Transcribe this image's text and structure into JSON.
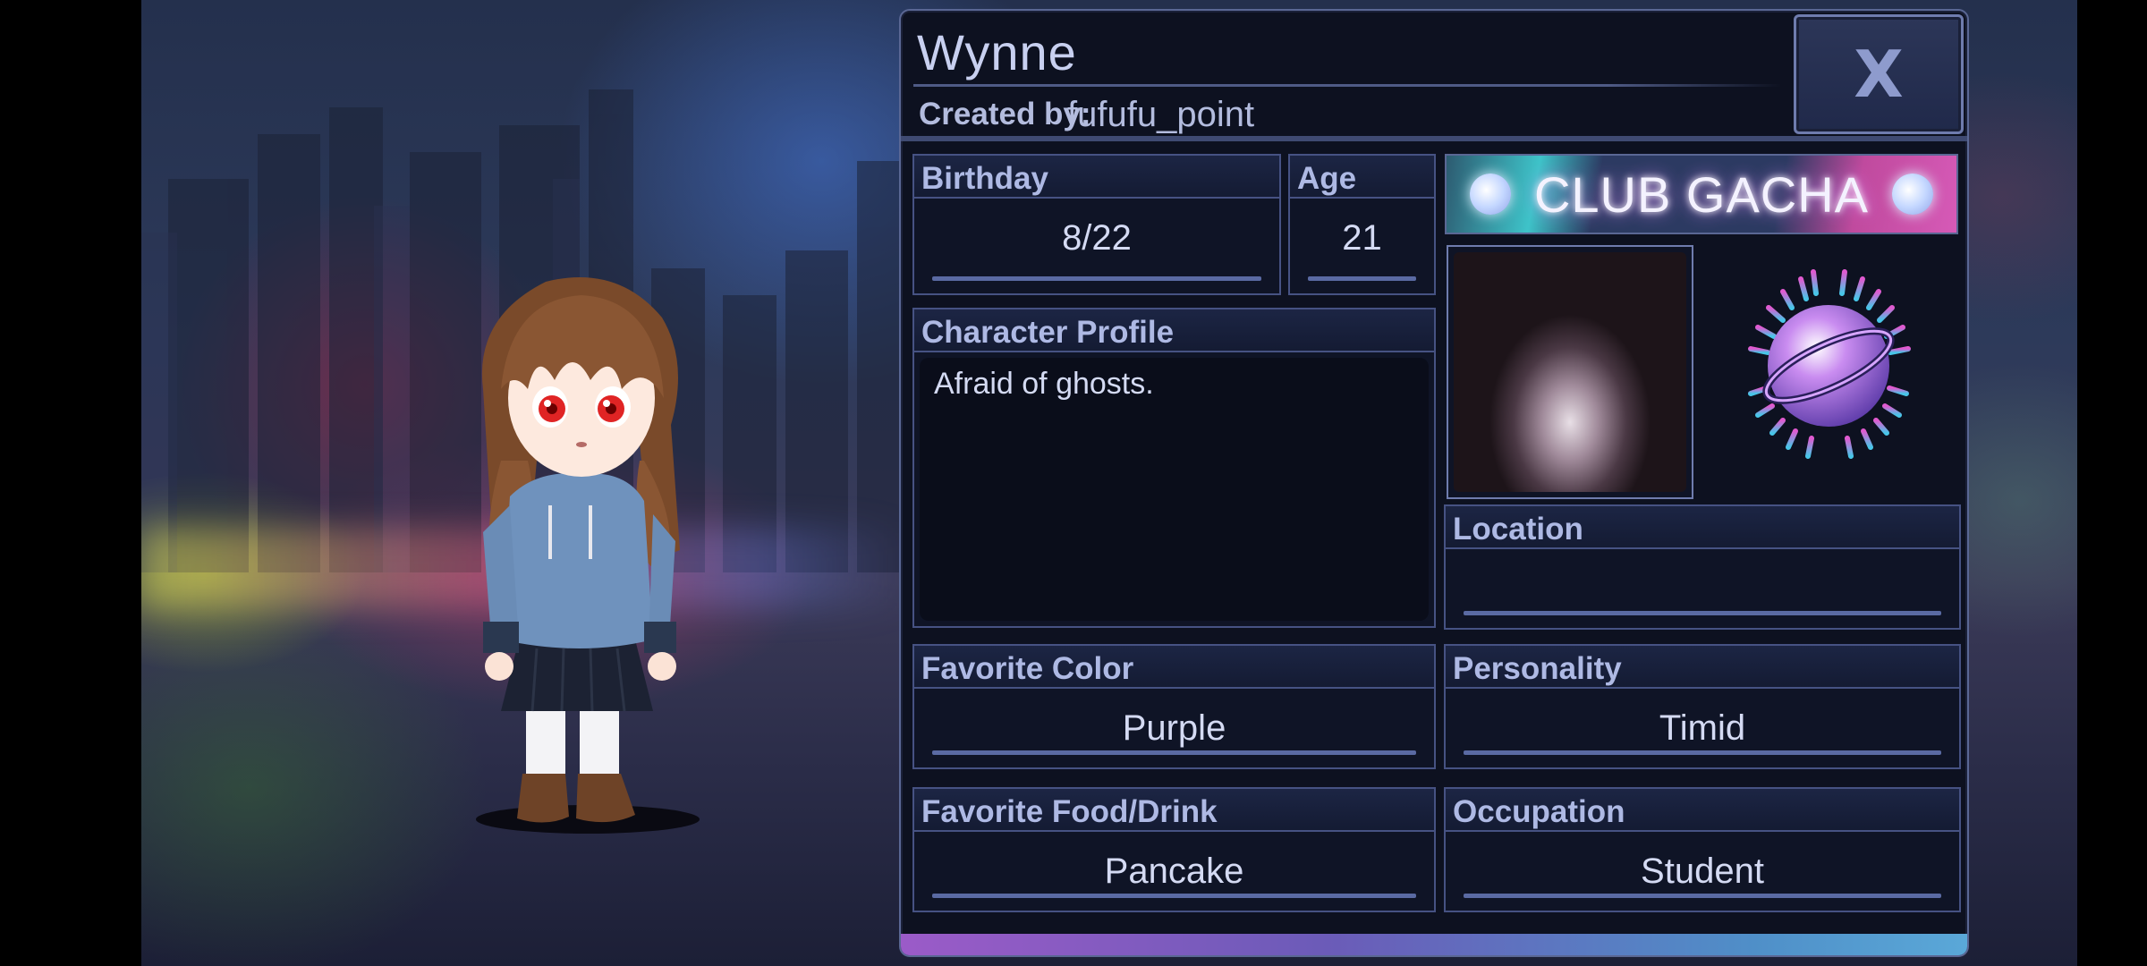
{
  "character": {
    "name": "Wynne",
    "created_by_label": "Created by:",
    "creator": "fufufu_point"
  },
  "close_button": {
    "label": "X"
  },
  "fields": {
    "birthday": {
      "label": "Birthday",
      "value": "8/22"
    },
    "age": {
      "label": "Age",
      "value": "21"
    },
    "profile": {
      "label": "Character Profile",
      "value": "Afraid of ghosts."
    },
    "location": {
      "label": "Location",
      "value": ""
    },
    "favorite_color": {
      "label": "Favorite Color",
      "value": "Purple"
    },
    "personality": {
      "label": "Personality",
      "value": "Timid"
    },
    "favorite_food": {
      "label": "Favorite Food/Drink",
      "value": "Pancake"
    },
    "occupation": {
      "label": "Occupation",
      "value": "Student"
    }
  },
  "banner": {
    "text": "CLUB GACHA"
  },
  "colors": {
    "panel_bg": "#0d1120",
    "panel_border": "#5a6794",
    "label_text": "#aeb9e4",
    "value_text": "#d4daf3",
    "underline": "#5a6aa3",
    "accent_cyan": "#3ec3c9",
    "accent_pink": "#d65ab7"
  },
  "icons": [
    "close-icon",
    "club-gacha-logo",
    "orb-icon"
  ]
}
